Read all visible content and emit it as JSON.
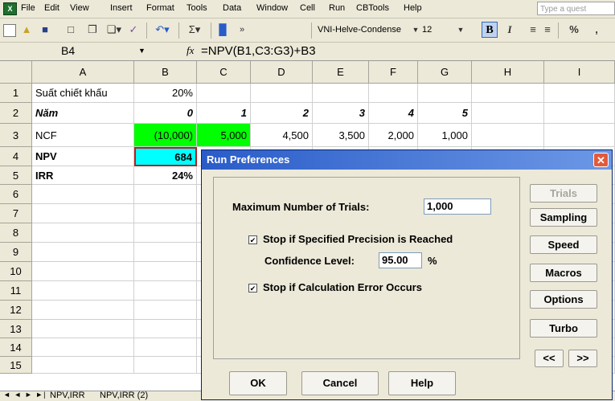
{
  "menu": {
    "items": [
      "File",
      "Edit",
      "View",
      "Insert",
      "Format",
      "Tools",
      "Data",
      "Window",
      "Cell",
      "Run",
      "CBTools",
      "Help"
    ],
    "help_placeholder": "Type a quest"
  },
  "toolbar": {
    "font_name": "VNI-Helve-Condense",
    "font_size": "12",
    "bold": "B",
    "italic": "I",
    "sigma": "Σ",
    "percent": "%",
    "comma": ","
  },
  "formula_bar": {
    "name_box": "B4",
    "fx": "fx",
    "formula": "=NPV(B1,C3:G3)+B3"
  },
  "sheet": {
    "columns": [
      "A",
      "B",
      "C",
      "D",
      "E",
      "F",
      "G",
      "H",
      "I"
    ],
    "rows": [
      "1",
      "2",
      "3",
      "4",
      "5",
      "6",
      "7",
      "8",
      "9",
      "10",
      "11",
      "12",
      "13",
      "14",
      "15"
    ],
    "cells": {
      "A1": "Suất chiết khấu",
      "B1": "20%",
      "A2": "Năm",
      "B2": "0",
      "C2": "1",
      "D2": "2",
      "E2": "3",
      "F2": "4",
      "G2": "5",
      "A3": "NCF",
      "B3": "(10,000)",
      "C3": "5,000",
      "D3": "4,500",
      "E3": "3,500",
      "F3": "2,000",
      "G3": "1,000",
      "A4": "NPV",
      "B4": "684",
      "A5": "IRR",
      "B5": "24%"
    },
    "colors": {
      "green": "#00ff00",
      "cyan": "#00ffff",
      "select_border": "#b22222"
    }
  },
  "tabs": {
    "nav": "◄ ◄ ► ►|",
    "sheet1": "NPV,IRR",
    "sheet2": "NPV,IRR (2)"
  },
  "dialog": {
    "title": "Run Preferences",
    "max_trials_label": "Maximum Number of Trials:",
    "max_trials_value": "1,000",
    "precision_label": "Stop if Specified Precision is Reached",
    "precision_checked": true,
    "confidence_label": "Confidence Level:",
    "confidence_value": "95.00",
    "confidence_unit": "%",
    "calc_error_label": "Stop if Calculation Error Occurs",
    "calc_error_checked": true,
    "side_buttons": [
      "Trials",
      "Sampling",
      "Speed",
      "Macros",
      "Options",
      "Turbo"
    ],
    "prev": "<<",
    "next": ">>",
    "ok": "OK",
    "cancel": "Cancel",
    "help": "Help",
    "title_color": "#2a5cc8"
  }
}
